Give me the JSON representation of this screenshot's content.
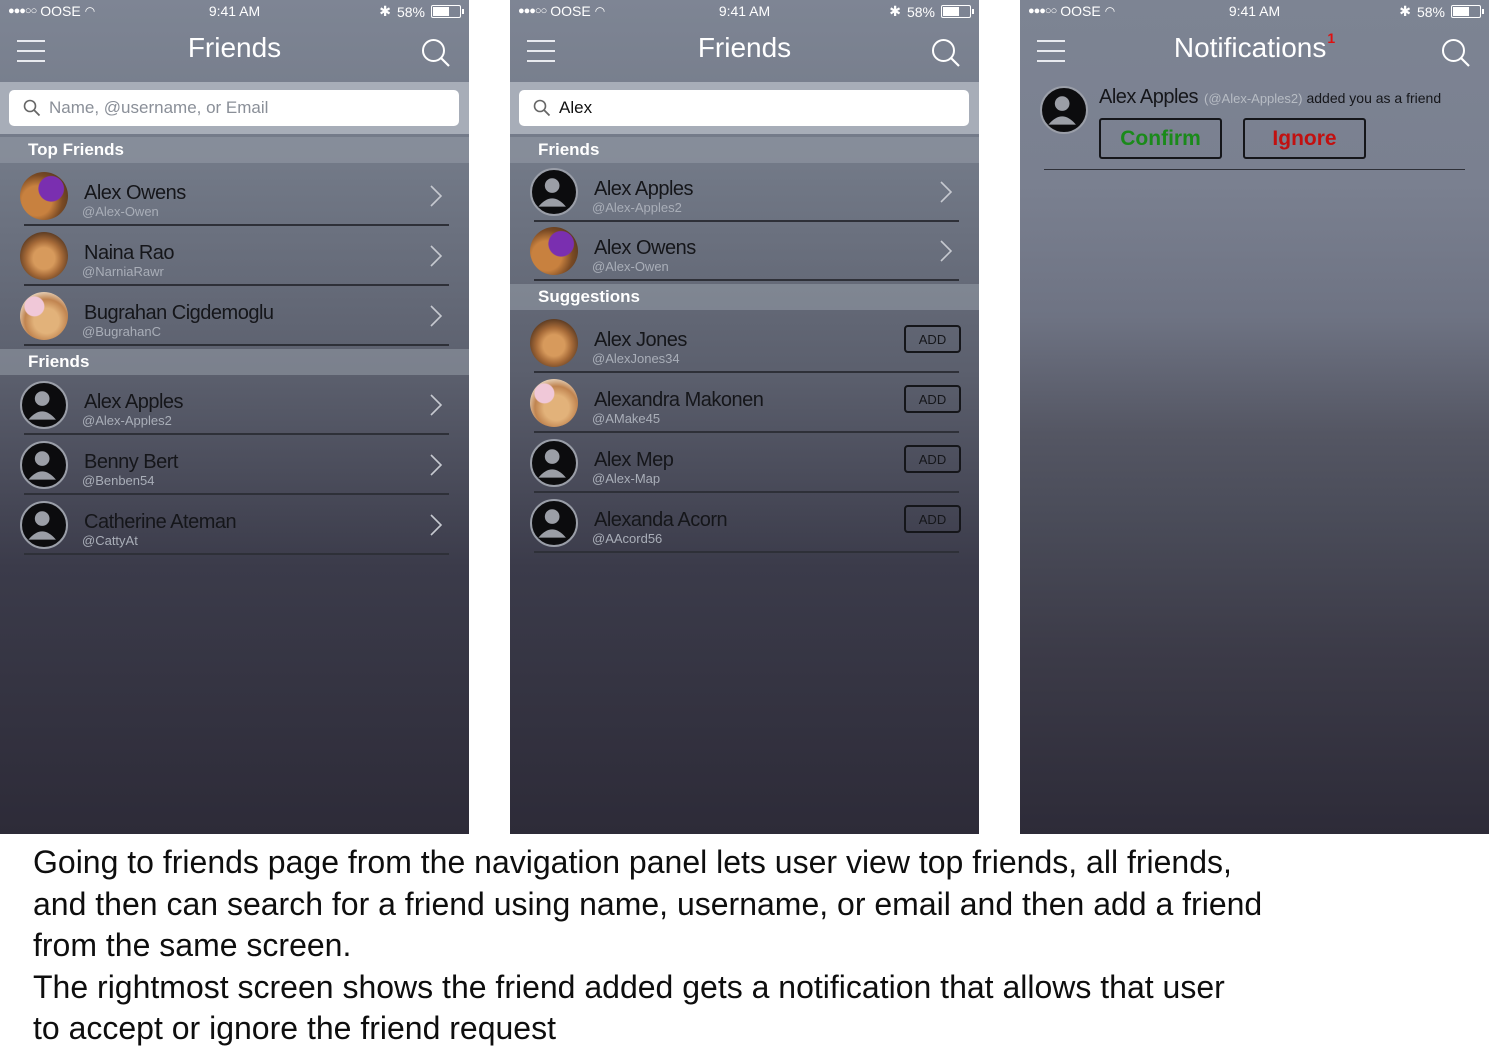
{
  "status": {
    "carrier": "OOSE",
    "signal": "●●●○○",
    "time": "9:41 AM",
    "battery": "58%",
    "battery_level": 0.58
  },
  "screen1": {
    "title": "Friends",
    "search_placeholder": "Name, @username, or Email",
    "sections": {
      "top_friends": "Top Friends",
      "friends": "Friends"
    },
    "top_friends": [
      {
        "name": "Alex Owens",
        "handle": "@Alex-Owen",
        "avatar": "photo-purple"
      },
      {
        "name": "Naina Rao",
        "handle": "@NarniaRawr",
        "avatar": "photo-dog"
      },
      {
        "name": "Bugrahan Cigdemoglu",
        "handle": "@BugrahanC",
        "avatar": "photo-pink"
      }
    ],
    "friends": [
      {
        "name": "Alex Apples",
        "handle": "@Alex-Apples2"
      },
      {
        "name": "Benny Bert",
        "handle": "@Benben54"
      },
      {
        "name": "Catherine Ateman",
        "handle": "@CattyAt"
      }
    ]
  },
  "screen2": {
    "title": "Friends",
    "search_value": "Alex",
    "sections": {
      "friends": "Friends",
      "suggestions": "Suggestions"
    },
    "friends": [
      {
        "name": "Alex Apples",
        "handle": "@Alex-Apples2"
      },
      {
        "name": "Alex Owens",
        "handle": "@Alex-Owen"
      }
    ],
    "add_label": "ADD",
    "suggestions": [
      {
        "name": "Alex Jones",
        "handle": "@AlexJones34"
      },
      {
        "name": "Alexandra Makonen",
        "handle": "@AMake45"
      },
      {
        "name": "Alex Mep",
        "handle": "@Alex-Map"
      },
      {
        "name": "Alexanda Acorn",
        "handle": "@AAcord56"
      }
    ]
  },
  "screen3": {
    "title": "Notifications",
    "badge": "1",
    "notification": {
      "name": "Alex Apples",
      "handle": "(@Alex-Apples2)",
      "message": "added you as a friend",
      "confirm_label": "Confirm",
      "ignore_label": "Ignore"
    }
  },
  "caption": {
    "line1": "Going to friends page from the navigation panel lets user view top friends, all friends,",
    "line2": "and then can search for a friend using name, username, or email and then add a friend",
    "line3": "from the same screen.",
    "line4": "The rightmost screen shows the friend added gets a notification that allows that user",
    "line5": "to accept or ignore the friend request"
  },
  "colors": {
    "confirm": "#1a8a1a",
    "ignore": "#c21010",
    "badge": "#e01010"
  }
}
